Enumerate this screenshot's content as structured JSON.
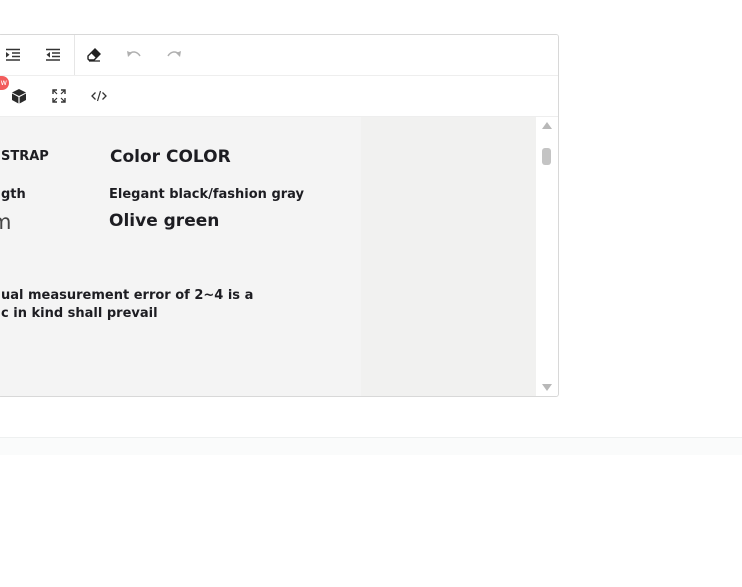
{
  "toolbar": {
    "row1": [
      {
        "name": "indent-icon",
        "title": "Indent"
      },
      {
        "name": "outdent-icon",
        "title": "Outdent"
      },
      {
        "name": "eraser-icon",
        "title": "Clear formatting"
      },
      {
        "name": "undo-icon",
        "title": "Undo"
      },
      {
        "name": "redo-icon",
        "title": "Redo"
      }
    ],
    "row2": [
      {
        "name": "cube-icon",
        "title": "Insert block"
      },
      {
        "name": "fullscreen-icon",
        "title": "Fullscreen"
      },
      {
        "name": "code-icon",
        "title": "Source code"
      }
    ],
    "new_badge": "w"
  },
  "content": {
    "heading_strap": "STRAP",
    "heading_color": "Color COLOR",
    "length_label": "gth",
    "length_value": "m",
    "color_options": "Elegant black/fashion gray",
    "color_value": "Olive green",
    "note_line1": "ual measurement error of 2~4 is a",
    "note_line2": "c in kind shall prevail"
  },
  "colors": {
    "border": "#d8d8d8",
    "icon": "#333333",
    "icon_disabled": "#b0b0b0",
    "badge": "#f25c5c",
    "content_bg": "#f4f4f4",
    "text": "#1d1d22"
  }
}
